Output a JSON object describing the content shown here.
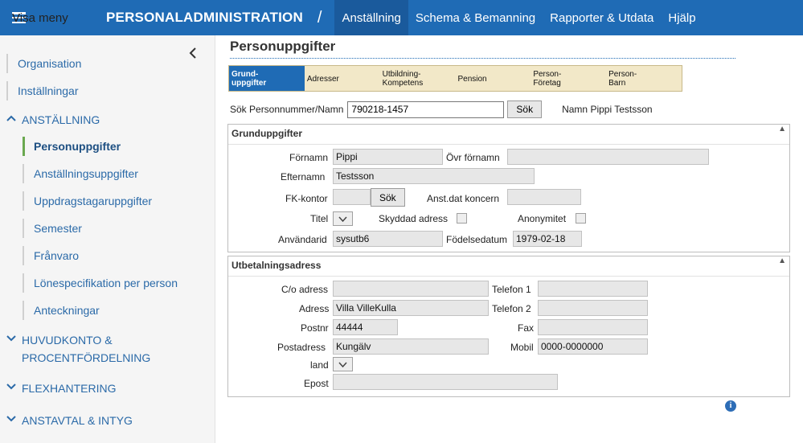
{
  "topbar": {
    "menu_label": "Visa meny",
    "app_title": "PERSONALADMINISTRATION",
    "separator": "/",
    "nav": [
      "Anställning",
      "Schema & Bemanning",
      "Rapporter & Utdata",
      "Hjälp"
    ],
    "active_nav": "Anställning"
  },
  "sidebar": {
    "top_items": [
      "Organisation",
      "Inställningar"
    ],
    "sections": [
      {
        "label": "ANSTÄLLNING",
        "expanded": true,
        "items": [
          "Personuppgifter",
          "Anställningsuppgifter",
          "Uppdragstagaruppgifter",
          "Semester",
          "Frånvaro",
          "Lönespecifikation per person",
          "Anteckningar"
        ],
        "active": "Personuppgifter"
      },
      {
        "label_line1": "HUVUDKONTO &",
        "label_line2": "PROCENTFÖRDELNING",
        "expanded": false
      },
      {
        "label": "FLEXHANTERING",
        "expanded": false
      },
      {
        "label": "ANSTAVTAL & INTYG",
        "expanded": false
      }
    ]
  },
  "page": {
    "title": "Personuppgifter"
  },
  "tabs": [
    {
      "l1": "Grund-",
      "l2": "uppgifter",
      "active": true
    },
    {
      "l1": "Adresser",
      "l2": ""
    },
    {
      "l1": "Utbildning-",
      "l2": "Kompetens"
    },
    {
      "l1": "Pension",
      "l2": ""
    },
    {
      "l1": "Person-",
      "l2": "Företag"
    },
    {
      "l1": "Person-",
      "l2": "Barn"
    }
  ],
  "search": {
    "label": "Sök Personnummer/Namn",
    "value": "790218-1457",
    "button": "Sök",
    "name_label": "Namn",
    "name_value": "Pippi Testsson"
  },
  "grund": {
    "title": "Grunduppgifter",
    "fornamn_label": "Förnamn",
    "fornamn": "Pippi",
    "ovr_fornamn_label": "Övr förnamn",
    "ovr_fornamn": "",
    "efternamn_label": "Efternamn",
    "efternamn": "Testsson",
    "fk_label": "FK-kontor",
    "fk_value": "",
    "fk_button": "Sök",
    "anst_label": "Anst.dat koncern",
    "anst_value": "",
    "titel_label": "Titel",
    "skyddad_label": "Skyddad adress",
    "anonymitet_label": "Anonymitet",
    "anvandarid_label": "Användarid",
    "anvandarid": "sysutb6",
    "fodelse_label": "Födelsedatum",
    "fodelse": "1979-02-18"
  },
  "utbet": {
    "title": "Utbetalningsadress",
    "co_label": "C/o adress",
    "co_value": "",
    "adress_label": "Adress",
    "adress": "Villa VilleKulla",
    "postnr_label": "Postnr",
    "postnr": "44444",
    "postadress_label": "Postadress",
    "postadress": "Kungälv",
    "land_label": "land",
    "epost_label": "Epost",
    "epost": "",
    "tel1_label": "Telefon 1",
    "tel1": "",
    "tel2_label": "Telefon 2",
    "tel2": "",
    "fax_label": "Fax",
    "fax": "",
    "mobil_label": "Mobil",
    "mobil": "0000-0000000"
  },
  "info_glyph": "i",
  "colors": {
    "topbar": "#1f6bb5",
    "active_nav": "#1a5a9c",
    "link": "#2b6aa8",
    "active_marker": "#6aa84f",
    "tab_bg": "#f2e8c8"
  }
}
